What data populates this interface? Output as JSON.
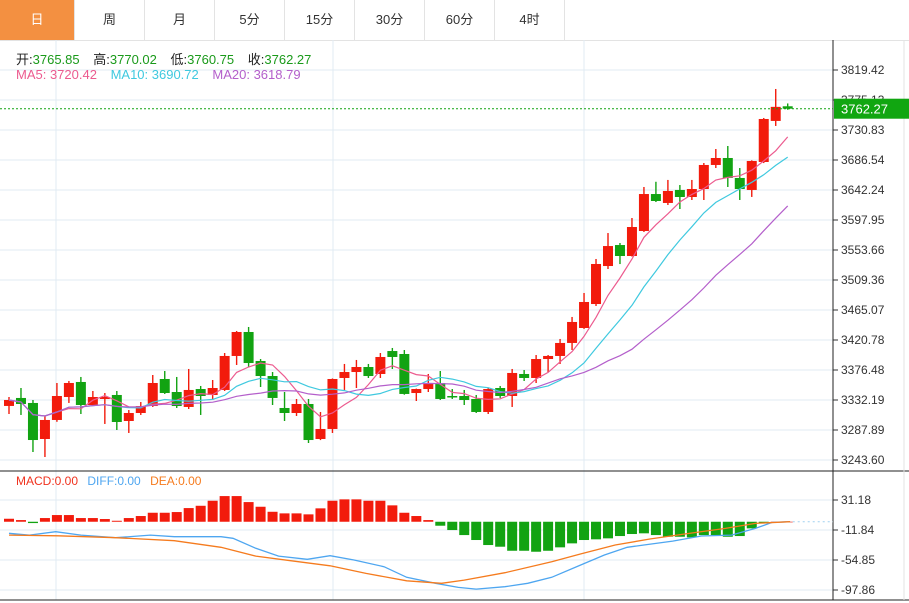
{
  "tabs": [
    {
      "label": "日",
      "active": true
    },
    {
      "label": "周",
      "active": false
    },
    {
      "label": "月",
      "active": false
    },
    {
      "label": "5分",
      "active": false
    },
    {
      "label": "15分",
      "active": false
    },
    {
      "label": "30分",
      "active": false
    },
    {
      "label": "60分",
      "active": false
    },
    {
      "label": "4时",
      "active": false
    }
  ],
  "ohlc_info": {
    "open_label": "开:",
    "open": "3765.85",
    "high_label": "高:",
    "high": "3770.02",
    "low_label": "低:",
    "low": "3760.75",
    "close_label": "收:",
    "close": "3762.27"
  },
  "ma_info": {
    "ma5": "MA5: 3720.42",
    "ma10": "MA10: 3690.72",
    "ma20": "MA20: 3618.79"
  },
  "macd_info": {
    "macd": "MACD:0.00",
    "diff": "DIFF:0.00",
    "dea": "DEA:0.00"
  },
  "current_price": "3762.27",
  "colors": {
    "up": "#f21b0c",
    "down": "#12a312",
    "ma5": "#ec5b8f",
    "ma10": "#3fc9df",
    "ma20": "#b45fcb",
    "diff": "#4ea6f0",
    "dea": "#f57b1e",
    "active_tab": "#f39041",
    "grid": "#e1ebf3"
  },
  "chart_data": [
    {
      "type": "candlestick",
      "yticks": [
        "3819.42",
        "3775.13",
        "3730.83",
        "3686.54",
        "3642.24",
        "3597.95",
        "3553.66",
        "3509.36",
        "3465.07",
        "3420.78",
        "3376.48",
        "3332.19",
        "3287.89",
        "3243.60"
      ],
      "ylim": [
        3243.6,
        3819.42
      ],
      "grid": true,
      "moving_averages": [
        "MA5",
        "MA10",
        "MA20"
      ],
      "candles_ohlc": [
        [
          3323.4,
          3336.6,
          3311.5,
          3332.2
        ],
        [
          3335.2,
          3349.9,
          3310.1,
          3326.3
        ],
        [
          3327.8,
          3332.2,
          3255.4,
          3273.1
        ],
        [
          3274.6,
          3308.6,
          3248.0,
          3302.7
        ],
        [
          3302.7,
          3357.3,
          3300.0,
          3338.1
        ],
        [
          3336.6,
          3360.3,
          3327.8,
          3357.3
        ],
        [
          3358.8,
          3366.2,
          3311.5,
          3324.8
        ],
        [
          3324.8,
          3345.5,
          3323.3,
          3336.6
        ],
        [
          3333.7,
          3342.5,
          3296.8,
          3336.6
        ],
        [
          3339.6,
          3345.5,
          3287.9,
          3299.7
        ],
        [
          3301.2,
          3317.4,
          3283.5,
          3313.0
        ],
        [
          3313.0,
          3329.2,
          3310.1,
          3323.3
        ],
        [
          3323.3,
          3369.1,
          3321.9,
          3357.3
        ],
        [
          3363.2,
          3375.0,
          3341.1,
          3342.5
        ],
        [
          3344.0,
          3366.2,
          3320.4,
          3323.3
        ],
        [
          3321.9,
          3378.0,
          3318.9,
          3347.0
        ],
        [
          3348.4,
          3352.9,
          3310.1,
          3338.1
        ],
        [
          3339.6,
          3361.7,
          3332.2,
          3349.9
        ],
        [
          3347.0,
          3401.6,
          3345.5,
          3397.2
        ],
        [
          3397.2,
          3434.1,
          3383.9,
          3432.6
        ],
        [
          3432.6,
          3440.0,
          3380.9,
          3386.8
        ],
        [
          3389.8,
          3392.7,
          3351.4,
          3367.6
        ],
        [
          3367.6,
          3373.5,
          3324.8,
          3335.2
        ],
        [
          3320.4,
          3344.0,
          3301.2,
          3313.0
        ],
        [
          3313.0,
          3333.7,
          3308.6,
          3326.3
        ],
        [
          3326.3,
          3333.7,
          3268.7,
          3273.1
        ],
        [
          3274.6,
          3314.5,
          3273.0,
          3289.4
        ],
        [
          3289.4,
          3364.0,
          3283.5,
          3363.2
        ],
        [
          3364.7,
          3385.4,
          3347.0,
          3373.5
        ],
        [
          3373.5,
          3391.3,
          3349.9,
          3380.9
        ],
        [
          3380.9,
          3385.4,
          3364.7,
          3367.6
        ],
        [
          3370.6,
          3401.6,
          3364.7,
          3395.7
        ],
        [
          3404.5,
          3409.0,
          3378.0,
          3395.7
        ],
        [
          3400.1,
          3406.0,
          3340.0,
          3341.1
        ],
        [
          3342.5,
          3349.0,
          3330.7,
          3348.4
        ],
        [
          3348.4,
          3370.6,
          3344.0,
          3357.3
        ],
        [
          3357.3,
          3375.0,
          3332.2,
          3333.7
        ],
        [
          3338.1,
          3348.4,
          3333.7,
          3336.6
        ],
        [
          3338.1,
          3347.0,
          3324.8,
          3332.2
        ],
        [
          3333.7,
          3339.6,
          3313.0,
          3314.5
        ],
        [
          3314.5,
          3349.9,
          3311.5,
          3348.4
        ],
        [
          3349.9,
          3352.9,
          3335.2,
          3338.1
        ],
        [
          3338.1,
          3378.0,
          3321.9,
          3372.1
        ],
        [
          3370.6,
          3376.5,
          3360.3,
          3364.7
        ],
        [
          3364.7,
          3398.6,
          3357.3,
          3392.7
        ],
        [
          3392.7,
          3398.6,
          3373.5,
          3397.2
        ],
        [
          3397.2,
          3422.3,
          3385.4,
          3416.4
        ],
        [
          3416.4,
          3454.8,
          3406.0,
          3447.4
        ],
        [
          3438.5,
          3490.2,
          3437.1,
          3476.9
        ],
        [
          3473.9,
          3540.4,
          3471.0,
          3533.0
        ],
        [
          3530.0,
          3578.7,
          3525.6,
          3559.5
        ],
        [
          3561.0,
          3564.0,
          3532.9,
          3544.8
        ],
        [
          3544.8,
          3600.9,
          3544.0,
          3587.6
        ],
        [
          3581.7,
          3646.7,
          3580.3,
          3636.3
        ],
        [
          3636.3,
          3654.4,
          3624.5,
          3626.0
        ],
        [
          3623.1,
          3657.1,
          3620.1,
          3640.8
        ],
        [
          3642.3,
          3649.6,
          3614.2,
          3631.9
        ],
        [
          3631.9,
          3657.1,
          3627.5,
          3643.7
        ],
        [
          3643.7,
          3682.1,
          3627.5,
          3679.2
        ],
        [
          3679.2,
          3702.8,
          3674.7,
          3689.5
        ],
        [
          3689.5,
          3707.2,
          3646.7,
          3660.0
        ],
        [
          3660.0,
          3674.7,
          3627.5,
          3643.7
        ],
        [
          3642.3,
          3686.0,
          3632.0,
          3685.1
        ],
        [
          3683.6,
          3748.6,
          3682.0,
          3747.1
        ],
        [
          3744.2,
          3791.4,
          3736.8,
          3765.0
        ],
        [
          3765.85,
          3770.02,
          3760.75,
          3762.27
        ]
      ]
    },
    {
      "type": "macd",
      "yticks": [
        "31.18",
        "-11.84",
        "-54.85",
        "-97.86"
      ],
      "ylim": [
        -97.86,
        31.18
      ],
      "histogram": [
        4.3,
        2.4,
        -1.9,
        5.3,
        9.6,
        9.6,
        5.3,
        5.3,
        3.9,
        1.4,
        5.3,
        8.2,
        12.9,
        12.9,
        13.9,
        19.6,
        22.9,
        30.1,
        36.8,
        36.8,
        28.2,
        21.5,
        14.3,
        12.0,
        12.0,
        10.6,
        19.2,
        30.1,
        32.1,
        32.1,
        30.1,
        30.1,
        23.5,
        12.9,
        8.2,
        2.4,
        -5.7,
        -11.9,
        -19.1,
        -26.2,
        -33.4,
        -35.8,
        -41.6,
        -41.6,
        -43.0,
        -41.6,
        -36.7,
        -31.0,
        -26.2,
        -25.2,
        -23.8,
        -20.5,
        -17.6,
        -16.6,
        -19.1,
        -21.5,
        -21.5,
        -22.4,
        -19.1,
        -19.1,
        -21.5,
        -20.5,
        -9.5,
        -1.5,
        0,
        0
      ],
      "diff_points": [
        [
          1,
          -16.6
        ],
        [
          2.7,
          -19.1
        ],
        [
          4.9,
          -14.3
        ],
        [
          7,
          -19.1
        ],
        [
          9.9,
          -22.9
        ],
        [
          12.8,
          -19.1
        ],
        [
          14.8,
          -21.5
        ],
        [
          18.7,
          -21.5
        ],
        [
          19.7,
          -23.8
        ],
        [
          21.6,
          -38.1
        ],
        [
          23.5,
          -49.2
        ],
        [
          25.9,
          -53.9
        ],
        [
          27.8,
          -48.7
        ],
        [
          29.8,
          -54.9
        ],
        [
          32.3,
          -64.5
        ],
        [
          34.2,
          -79.7
        ],
        [
          36.6,
          -88.3
        ],
        [
          38.5,
          -94.1
        ],
        [
          40,
          -96.5
        ],
        [
          42.4,
          -93.2
        ],
        [
          44.3,
          -88.3
        ],
        [
          46.3,
          -79.7
        ],
        [
          48.7,
          -62.1
        ],
        [
          50.7,
          -47.7
        ],
        [
          52.6,
          -36.7
        ],
        [
          54,
          -33.4
        ],
        [
          56.4,
          -27.7
        ],
        [
          58.8,
          -20.5
        ],
        [
          61.3,
          -19.1
        ],
        [
          63.3,
          -9.5
        ],
        [
          64.7,
          -0.9
        ],
        [
          66.2,
          0
        ]
      ],
      "dea_points": [
        [
          1,
          -19.1
        ],
        [
          5.1,
          -20.1
        ],
        [
          9.9,
          -22.9
        ],
        [
          14.8,
          -27.2
        ],
        [
          18.7,
          -36.7
        ],
        [
          21.6,
          -49.2
        ],
        [
          24.5,
          -55.9
        ],
        [
          27.8,
          -63.1
        ],
        [
          30.8,
          -74.0
        ],
        [
          34.2,
          -84.6
        ],
        [
          37.1,
          -88.3
        ],
        [
          39,
          -83.6
        ],
        [
          42.4,
          -73.1
        ],
        [
          46.3,
          -57.3
        ],
        [
          48.7,
          -46.3
        ],
        [
          51.6,
          -33.4
        ],
        [
          54.5,
          -24.8
        ],
        [
          57.4,
          -17.6
        ],
        [
          60.8,
          -9.5
        ],
        [
          63.3,
          -2.3
        ],
        [
          66.2,
          0
        ]
      ]
    }
  ]
}
